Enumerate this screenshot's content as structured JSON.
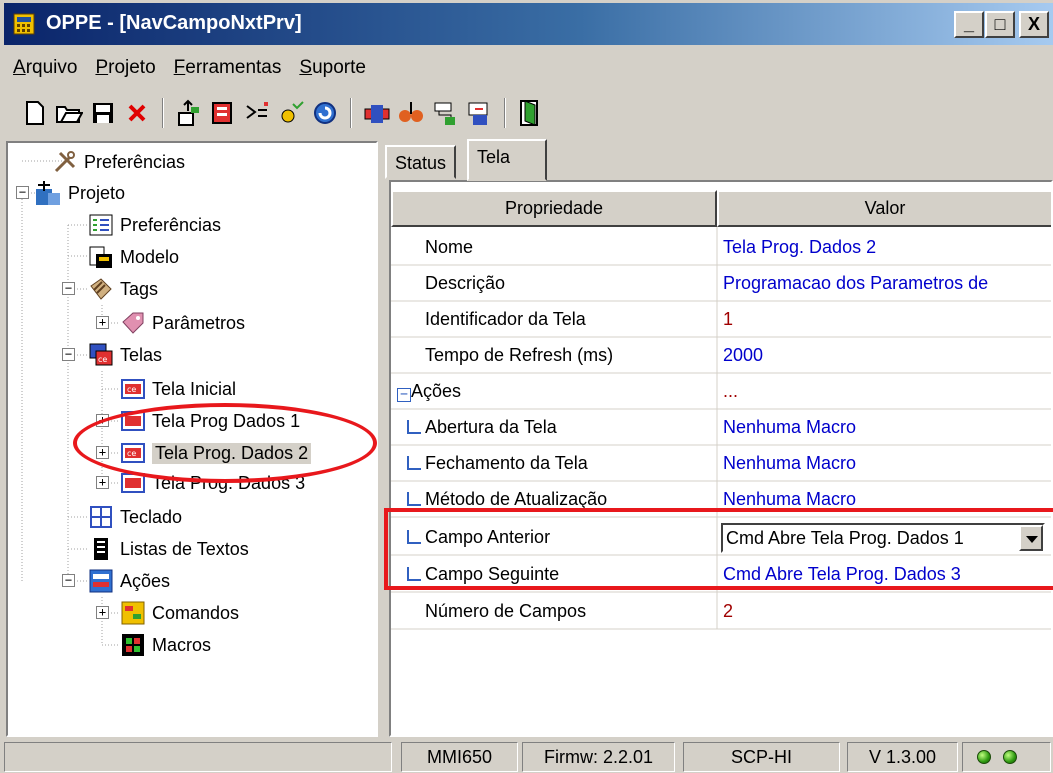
{
  "window": {
    "title": "OPPE - [NavCampoNxtPrv]",
    "buttons": {
      "minimize": "_",
      "maximize": "□",
      "close": "X"
    }
  },
  "menu": [
    {
      "mnemonic": "A",
      "rest": "rquivo"
    },
    {
      "mnemonic": "P",
      "rest": "rojeto"
    },
    {
      "mnemonic": "F",
      "rest": "erramentas"
    },
    {
      "mnemonic": "S",
      "rest": "uporte"
    }
  ],
  "toolbar": [
    {
      "icon": "new-file-icon"
    },
    {
      "icon": "open-folder-icon"
    },
    {
      "icon": "save-icon"
    },
    {
      "icon": "delete-icon"
    },
    {
      "icon": "upload-icon"
    },
    {
      "icon": "download-icon"
    },
    {
      "icon": "compile-icon"
    },
    {
      "icon": "verify-icon"
    },
    {
      "icon": "refresh-icon"
    },
    {
      "icon": "device-icon"
    },
    {
      "icon": "communication-icon"
    },
    {
      "icon": "simulate-icon"
    },
    {
      "icon": "monitor-icon"
    },
    {
      "icon": "exit-icon"
    }
  ],
  "tree": {
    "preferencias_root": "Preferências",
    "projeto": "Projeto",
    "preferencias": "Preferências",
    "modelo": "Modelo",
    "tags": "Tags",
    "parametros": "Parâmetros",
    "telas": "Telas",
    "tela_inicial": "Tela Inicial",
    "tela_prog_1": "Tela Prog Dados 1",
    "tela_prog_2": "Tela Prog. Dados 2",
    "tela_prog_3": "Tela Prog. Dados 3",
    "teclado": "Teclado",
    "listas": "Listas de Textos",
    "acoes": "Ações",
    "comandos": "Comandos",
    "macros": "Macros"
  },
  "tabs": {
    "status": "Status",
    "tela": "Tela"
  },
  "grid": {
    "header_prop": "Propriedade",
    "header_val": "Valor",
    "rows": [
      {
        "prop": "Nome",
        "val": "Tela Prog. Dados 2"
      },
      {
        "prop": "Descrição",
        "val": "Programacao dos Parametros de"
      },
      {
        "prop": "Identificador da Tela",
        "val": "1"
      },
      {
        "prop": "Tempo de Refresh (ms)",
        "val": "2000"
      },
      {
        "prop": "Ações",
        "val": "..."
      },
      {
        "prop": "Abertura da Tela",
        "val": "Nenhuma Macro"
      },
      {
        "prop": "Fechamento da Tela",
        "val": "Nenhuma Macro"
      },
      {
        "prop": "Método de Atualização",
        "val": "Nenhuma Macro"
      },
      {
        "prop": "Campo Anterior",
        "val": "Cmd Abre Tela Prog. Dados 1"
      },
      {
        "prop": "Campo Seguinte",
        "val": "Cmd Abre Tela Prog. Dados 3"
      },
      {
        "prop": "Número de Campos",
        "val": "2"
      }
    ]
  },
  "status": {
    "model": "MMI650",
    "firmware": "Firmw: 2.2.01",
    "protocol": "SCP-HI",
    "version": "V 1.3.00"
  },
  "colors": {
    "annotation": "#e8181c",
    "value_text": "#0000cc",
    "number_text": "#a00000"
  }
}
